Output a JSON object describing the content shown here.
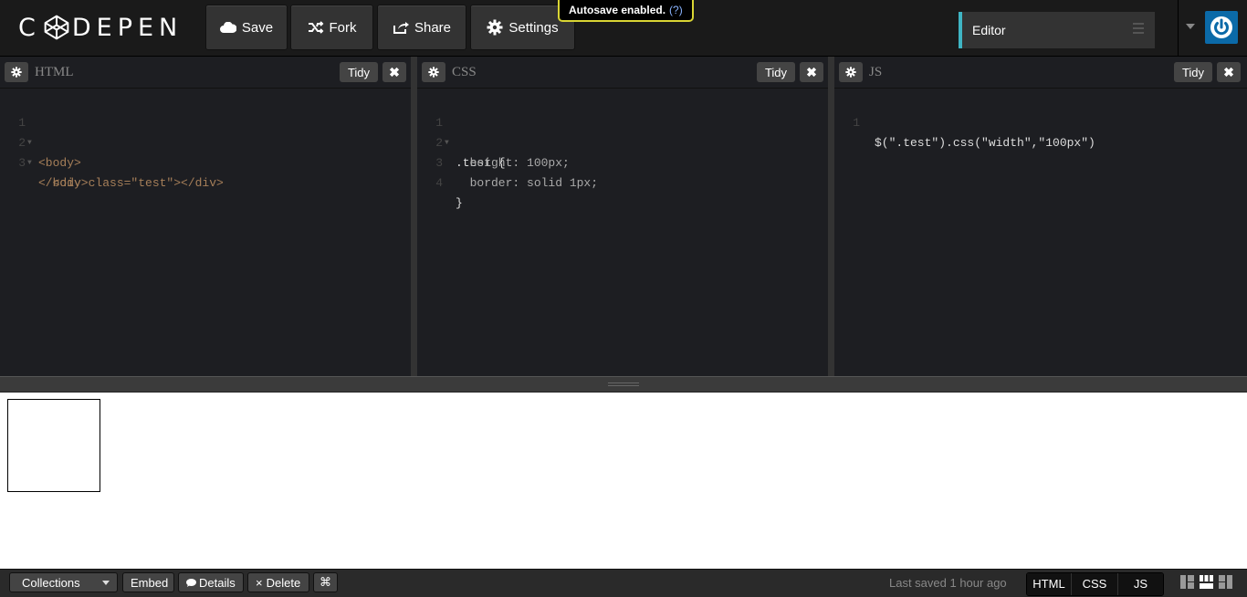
{
  "topbar": {
    "logo_text": "CODEPEN",
    "buttons": [
      {
        "label": "Save",
        "icon": "cloud-icon"
      },
      {
        "label": "Fork",
        "icon": "fork-icon"
      },
      {
        "label": "Share",
        "icon": "share-icon"
      },
      {
        "label": "Settings",
        "icon": "gear-icon"
      }
    ],
    "tooltip": {
      "text": "Autosave enabled.",
      "help": "(?)"
    },
    "view_select": "Editor"
  },
  "panes": {
    "html": {
      "title": "HTML",
      "tidy": "Tidy",
      "lines": [
        {
          "n": "1",
          "fold": true,
          "code": "<body>"
        },
        {
          "n": "2",
          "fold": true,
          "code": "  <div class=\"test\"></div>"
        },
        {
          "n": "3",
          "fold": false,
          "code": "</body>"
        }
      ]
    },
    "css": {
      "title": "CSS",
      "tidy": "Tidy",
      "lines": [
        {
          "n": "1",
          "fold": true,
          "code": ".test {"
        },
        {
          "n": "2",
          "fold": false,
          "code": "  height: 100px;"
        },
        {
          "n": "3",
          "fold": false,
          "code": "  border: solid 1px;"
        },
        {
          "n": "4",
          "fold": false,
          "code": "}"
        }
      ]
    },
    "js": {
      "title": "JS",
      "tidy": "Tidy",
      "lines": [
        {
          "n": "1",
          "fold": false,
          "code": "$(\".test\").css(\"width\",\"100px\")"
        }
      ]
    }
  },
  "bottombar": {
    "collections": "Collections",
    "embed": "Embed",
    "details": "Details",
    "delete": "Delete",
    "cmd": "⌘",
    "last_saved": "Last saved 1 hour ago",
    "tabs": [
      "HTML",
      "CSS",
      "JS"
    ]
  },
  "colors": {
    "accent": "#3fb5c4",
    "tooltip_border": "#d9d534",
    "power": "#0b6aa8"
  }
}
